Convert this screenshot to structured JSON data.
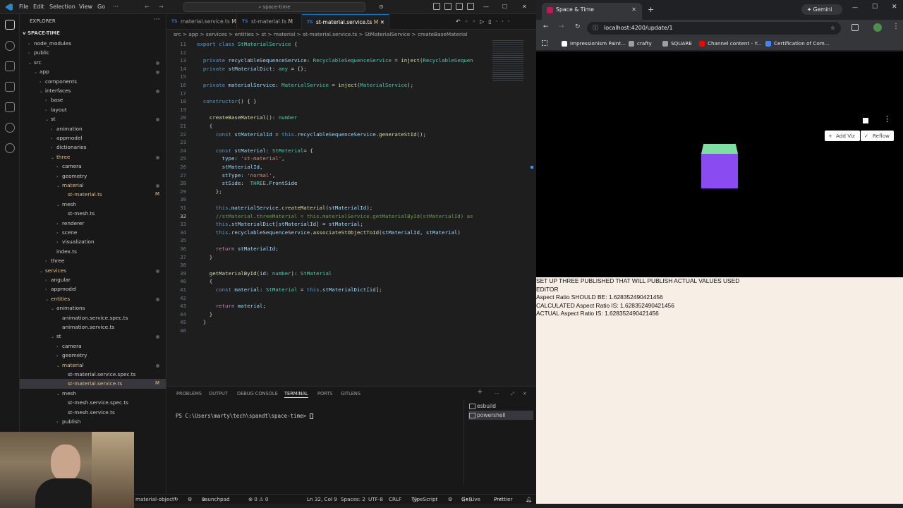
{
  "vscode": {
    "menu": [
      "File",
      "Edit",
      "Selection",
      "View",
      "Go",
      "···"
    ],
    "search": "space-time",
    "explorer_title": "EXPLORER",
    "project": "SPACE-TIME",
    "tree": [
      {
        "label": "node_modules",
        "depth": 1,
        "chev": ">"
      },
      {
        "label": "public",
        "depth": 1,
        "chev": ">"
      },
      {
        "label": "src",
        "depth": 1,
        "chev": "v",
        "dot": true
      },
      {
        "label": "app",
        "depth": 2,
        "chev": "v",
        "dot": true
      },
      {
        "label": "components",
        "depth": 3,
        "chev": ">"
      },
      {
        "label": "interfaces",
        "depth": 3,
        "chev": "v",
        "dot": true
      },
      {
        "label": "base",
        "depth": 4,
        "chev": ">"
      },
      {
        "label": "layout",
        "depth": 4,
        "chev": ">"
      },
      {
        "label": "st",
        "depth": 4,
        "chev": "v",
        "dot": true
      },
      {
        "label": "animation",
        "depth": 5,
        "chev": ">"
      },
      {
        "label": "appmodel",
        "depth": 5,
        "chev": ">"
      },
      {
        "label": "dictionaries",
        "depth": 5,
        "chev": ">"
      },
      {
        "label": "three",
        "depth": 5,
        "chev": "v",
        "dot": true,
        "mod": true
      },
      {
        "label": "camera",
        "depth": 6,
        "chev": ">"
      },
      {
        "label": "geometry",
        "depth": 6,
        "chev": ">"
      },
      {
        "label": "material",
        "depth": 6,
        "chev": "v",
        "dot": true,
        "mod": true
      },
      {
        "label": "st-material.ts",
        "depth": 7,
        "chev": "",
        "badge": "M",
        "mod": true
      },
      {
        "label": "mesh",
        "depth": 6,
        "chev": "v"
      },
      {
        "label": "st-mesh.ts",
        "depth": 7,
        "chev": ""
      },
      {
        "label": "renderer",
        "depth": 6,
        "chev": ">"
      },
      {
        "label": "scene",
        "depth": 6,
        "chev": ">"
      },
      {
        "label": "visualization",
        "depth": 6,
        "chev": ">"
      },
      {
        "label": "index.ts",
        "depth": 5,
        "chev": ""
      },
      {
        "label": "three",
        "depth": 4,
        "chev": ">"
      },
      {
        "label": "services",
        "depth": 3,
        "chev": "v",
        "dot": true,
        "mod": true
      },
      {
        "label": "angular",
        "depth": 4,
        "chev": ">"
      },
      {
        "label": "appmodel",
        "depth": 4,
        "chev": ">"
      },
      {
        "label": "entities",
        "depth": 4,
        "chev": "v",
        "dot": true,
        "mod": true
      },
      {
        "label": "animations",
        "depth": 5,
        "chev": "v"
      },
      {
        "label": "animation.service.spec.ts",
        "depth": 6,
        "chev": ""
      },
      {
        "label": "animation.service.ts",
        "depth": 6,
        "chev": ""
      },
      {
        "label": "st",
        "depth": 5,
        "chev": "v",
        "dot": true
      },
      {
        "label": "camera",
        "depth": 6,
        "chev": ">"
      },
      {
        "label": "geometry",
        "depth": 6,
        "chev": ">"
      },
      {
        "label": "material",
        "depth": 6,
        "chev": "v",
        "dot": true,
        "mod": true
      },
      {
        "label": "st-material.service.spec.ts",
        "depth": 7,
        "chev": ""
      },
      {
        "label": "st-material.service.ts",
        "depth": 7,
        "chev": "",
        "badge": "M",
        "mod": true,
        "sel": true
      },
      {
        "label": "mesh",
        "depth": 6,
        "chev": "v"
      },
      {
        "label": "st-mesh.service.spec.ts",
        "depth": 7,
        "chev": ""
      },
      {
        "label": "st-mesh.service.ts",
        "depth": 7,
        "chev": ""
      },
      {
        "label": "publish",
        "depth": 6,
        "chev": ">"
      }
    ],
    "tabs": [
      {
        "label": "material.service.ts",
        "badge": "M",
        "active": false
      },
      {
        "label": "st-material.ts",
        "badge": "M",
        "active": false
      },
      {
        "label": "st-material.service.ts",
        "badge": "M",
        "active": true
      }
    ],
    "breadcrumb": "src > app > services > entities > st > material > st-material.service.ts > StMaterialService > createBaseMaterial",
    "code": [
      {
        "n": "11",
        "t": [
          [
            "kw",
            "export "
          ],
          [
            "kw",
            "class "
          ],
          [
            "ty",
            "StMaterialService "
          ],
          [
            "pu",
            "{"
          ]
        ]
      },
      {
        "n": "12",
        "t": []
      },
      {
        "n": "13",
        "t": [
          [
            "kw",
            "  private "
          ],
          [
            "pr",
            "recyclableSequenceService"
          ],
          [
            "pu",
            ": "
          ],
          [
            "ty",
            "RecyclableSequenceService"
          ],
          [
            "pu",
            " = "
          ],
          [
            "fn",
            "inject"
          ],
          [
            "pu",
            "("
          ],
          [
            "ty",
            "RecyclableSequen"
          ]
        ]
      },
      {
        "n": "14",
        "t": [
          [
            "kw",
            "  private "
          ],
          [
            "pr",
            "stMaterialDict"
          ],
          [
            "pu",
            ": "
          ],
          [
            "ty",
            "any"
          ],
          [
            "pu",
            " = {};"
          ]
        ]
      },
      {
        "n": "15",
        "t": []
      },
      {
        "n": "16",
        "t": [
          [
            "kw",
            "  private "
          ],
          [
            "pr",
            "materialService"
          ],
          [
            "pu",
            ": "
          ],
          [
            "ty",
            "MaterialService"
          ],
          [
            "pu",
            " = "
          ],
          [
            "fn",
            "inject"
          ],
          [
            "pu",
            "("
          ],
          [
            "ty",
            "MaterialService"
          ],
          [
            "pu",
            ");"
          ]
        ]
      },
      {
        "n": "17",
        "t": []
      },
      {
        "n": "18",
        "t": [
          [
            "kw",
            "  constructor"
          ],
          [
            "pu",
            "() { }"
          ]
        ]
      },
      {
        "n": "19",
        "t": []
      },
      {
        "n": "20",
        "t": [
          [
            "fn",
            "    createBaseMaterial"
          ],
          [
            "pu",
            "(): "
          ],
          [
            "ty",
            "number"
          ]
        ]
      },
      {
        "n": "21",
        "t": [
          [
            "pu",
            "    {"
          ]
        ]
      },
      {
        "n": "22",
        "t": [
          [
            "kw",
            "      const "
          ],
          [
            "pr",
            "stMaterialId"
          ],
          [
            "pu",
            " = "
          ],
          [
            "kw",
            "this"
          ],
          [
            "pu",
            "."
          ],
          [
            "pr",
            "recyclableSequenceService"
          ],
          [
            "pu",
            "."
          ],
          [
            "fn",
            "generateStId"
          ],
          [
            "pu",
            "();"
          ]
        ]
      },
      {
        "n": "23",
        "t": []
      },
      {
        "n": "24",
        "t": [
          [
            "kw",
            "      const "
          ],
          [
            "pr",
            "stMaterial"
          ],
          [
            "pu",
            ": "
          ],
          [
            "ty",
            "StMaterial"
          ],
          [
            "pu",
            "= {"
          ]
        ]
      },
      {
        "n": "25",
        "t": [
          [
            "pr",
            "        type"
          ],
          [
            "pu",
            ": "
          ],
          [
            "st",
            "'st-material'"
          ],
          [
            "pu",
            ","
          ]
        ]
      },
      {
        "n": "26",
        "t": [
          [
            "pr",
            "        stMaterialId"
          ],
          [
            "pu",
            ","
          ]
        ]
      },
      {
        "n": "27",
        "t": [
          [
            "pr",
            "        stType"
          ],
          [
            "pu",
            ": "
          ],
          [
            "st",
            "'normal'"
          ],
          [
            "pu",
            ","
          ]
        ]
      },
      {
        "n": "28",
        "t": [
          [
            "pr",
            "        stSide"
          ],
          [
            "pu",
            ":  "
          ],
          [
            "ty",
            "THREE"
          ],
          [
            "pu",
            "."
          ],
          [
            "pr",
            "FrontSide"
          ]
        ]
      },
      {
        "n": "29",
        "t": [
          [
            "pu",
            "      };"
          ]
        ]
      },
      {
        "n": "30",
        "t": []
      },
      {
        "n": "31",
        "t": [
          [
            "kw",
            "      this"
          ],
          [
            "pu",
            "."
          ],
          [
            "pr",
            "materialService"
          ],
          [
            "pu",
            "."
          ],
          [
            "fn",
            "createMaterial"
          ],
          [
            "pu",
            "("
          ],
          [
            "pr",
            "stMaterialId"
          ],
          [
            "pu",
            ");"
          ]
        ]
      },
      {
        "n": "32",
        "t": [
          [
            "cm",
            "      //stMaterial.threeMaterial = this.materialService.getMaterialById(stMaterialId) as"
          ]
        ],
        "cur": true
      },
      {
        "n": "33",
        "t": [
          [
            "kw",
            "      this"
          ],
          [
            "pu",
            "."
          ],
          [
            "pr",
            "stMaterialDict"
          ],
          [
            "pu",
            "["
          ],
          [
            "pr",
            "stMaterialId"
          ],
          [
            "pu",
            "] = "
          ],
          [
            "pr",
            "stMaterial"
          ],
          [
            "pu",
            ";"
          ]
        ]
      },
      {
        "n": "34",
        "t": [
          [
            "kw",
            "      this"
          ],
          [
            "pu",
            "."
          ],
          [
            "pr",
            "recyclableSequenceService"
          ],
          [
            "pu",
            "."
          ],
          [
            "fn",
            "associateStObjectToId"
          ],
          [
            "pu",
            "("
          ],
          [
            "pr",
            "stMaterialId"
          ],
          [
            "pu",
            ", "
          ],
          [
            "pr",
            "stMaterial"
          ],
          [
            "pu",
            ")"
          ]
        ]
      },
      {
        "n": "35",
        "t": []
      },
      {
        "n": "36",
        "t": [
          [
            "ctl",
            "      return "
          ],
          [
            "pr",
            "stMaterialId"
          ],
          [
            "pu",
            ";"
          ]
        ]
      },
      {
        "n": "37",
        "t": [
          [
            "pu",
            "    }"
          ]
        ]
      },
      {
        "n": "38",
        "t": []
      },
      {
        "n": "39",
        "t": [
          [
            "fn",
            "    getMaterialById"
          ],
          [
            "pu",
            "("
          ],
          [
            "pr",
            "id"
          ],
          [
            "pu",
            ": "
          ],
          [
            "ty",
            "number"
          ],
          [
            "pu",
            "): "
          ],
          [
            "ty",
            "StMaterial"
          ]
        ]
      },
      {
        "n": "40",
        "t": [
          [
            "pu",
            "    {"
          ]
        ]
      },
      {
        "n": "41",
        "t": [
          [
            "kw",
            "      const "
          ],
          [
            "pr",
            "material"
          ],
          [
            "pu",
            ": "
          ],
          [
            "ty",
            "StMaterial"
          ],
          [
            "pu",
            " = "
          ],
          [
            "kw",
            "this"
          ],
          [
            "pu",
            "."
          ],
          [
            "pr",
            "stMaterialDict"
          ],
          [
            "pu",
            "["
          ],
          [
            "pr",
            "id"
          ],
          [
            "pu",
            "];"
          ]
        ]
      },
      {
        "n": "42",
        "t": []
      },
      {
        "n": "43",
        "t": [
          [
            "ctl",
            "      return "
          ],
          [
            "pr",
            "material"
          ],
          [
            "pu",
            ";"
          ]
        ]
      },
      {
        "n": "44",
        "t": [
          [
            "pu",
            "    }"
          ]
        ]
      },
      {
        "n": "45",
        "t": [
          [
            "pu",
            "  }"
          ]
        ]
      },
      {
        "n": "46",
        "t": []
      }
    ],
    "panel_tabs": [
      "PROBLEMS",
      "OUTPUT",
      "DEBUG CONSOLE",
      "TERMINAL",
      "PORTS",
      "GITLENS"
    ],
    "active_panel_tab": "TERMINAL",
    "terminal_prompt": "PS C:\\Users\\marty\\tech\\spandt\\space-time> ",
    "terminals": [
      "esbuild",
      "powershell"
    ],
    "status": {
      "branch": "material-object*",
      "launchpad": "Launchpad",
      "errors": "⊗ 0 ⚠ 0",
      "position": "Ln 32, Col 9",
      "spaces": "Spaces: 2",
      "encoding": "UTF-8",
      "eol": "CRLF",
      "language": "TypeScript",
      "golive": "Go Live",
      "prettier": "Prettier"
    }
  },
  "browser": {
    "tab_title": "Space & Time",
    "gemini": "Gemini",
    "url": "localhost:4200/update/1",
    "bookmarks": [
      {
        "label": "Impressionism Paint...",
        "color": "#ffffff"
      },
      {
        "label": "crafty",
        "color": "#9aa0a6"
      },
      {
        "label": "SQUARE",
        "color": "#9aa0a6"
      },
      {
        "label": "Channel content - Y...",
        "color": "#ff0000"
      },
      {
        "label": "Certification of Com...",
        "color": "#4285f4"
      }
    ],
    "add_viz": "Add Viz",
    "reflow": "Reflow",
    "info_lines": [
      "SET UP THREE PUBLISHED THAT WILL PUBLISH ACTUAL VALUES USED",
      "EDITOR",
      "Aspect Ratio SHOULD BE: 1.628352490421456",
      "CALCULATED Aspect Ratio IS: 1.628352490421456",
      "ACTUAL Aspect Ratio IS: 1.628352490421456"
    ],
    "cube_colors": {
      "top": "#7ee0a0",
      "front": "#8a4bf0"
    }
  }
}
